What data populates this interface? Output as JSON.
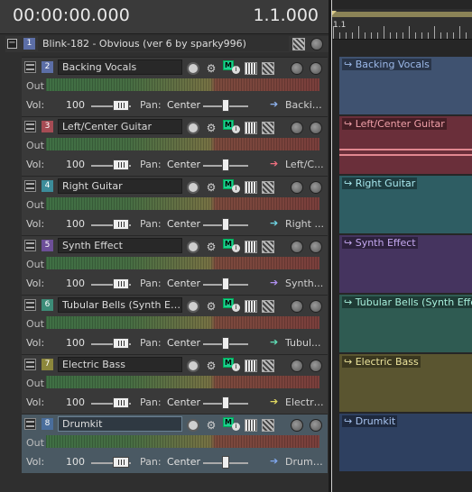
{
  "transport": {
    "time": "00:00:00.000",
    "beat": "1.1.000"
  },
  "ruler": {
    "label": "1.1"
  },
  "bus": {
    "number": "1",
    "name": "Blink-182 - Obvious (ver 6 by sparky996)",
    "expand": "−"
  },
  "labels": {
    "out": "Out",
    "vol": "Vol:",
    "pan": "Pan:",
    "monitor": "M"
  },
  "tracks": [
    {
      "number": "2",
      "name": "Backing Vocals",
      "volume": "100",
      "pan": "Center",
      "output": "Backin...",
      "clip": "Backing Vocals",
      "num_color": "#5c6ea6",
      "clip_color": "#3f5270",
      "label_color": "#9bb8e8",
      "arrow_color": "#8fb4f0",
      "selected": false
    },
    {
      "number": "3",
      "name": "Left/Center Guitar",
      "volume": "100",
      "pan": "Center",
      "output": "Left/C...",
      "clip": "Left/Center Guitar",
      "num_color": "#a64c54",
      "clip_color": "#6a2f3a",
      "label_color": "#f0a0a8",
      "arrow_color": "#f07080",
      "selected": false
    },
    {
      "number": "4",
      "name": "Right Guitar",
      "volume": "100",
      "pan": "Center",
      "output": "Right ...",
      "clip": "Right Guitar",
      "num_color": "#3c8c9a",
      "clip_color": "#2e5d63",
      "label_color": "#a8e8ee",
      "arrow_color": "#70d8e8",
      "selected": false
    },
    {
      "number": "5",
      "name": "Synth Effect",
      "volume": "100",
      "pan": "Center",
      "output": "Synth...",
      "clip": "Synth Effect",
      "num_color": "#6d4f98",
      "clip_color": "#45345f",
      "label_color": "#c4a8f0",
      "arrow_color": "#b090f0",
      "selected": false
    },
    {
      "number": "6",
      "name": "Tubular Bells (Synth Effe...",
      "volume": "100",
      "pan": "Center",
      "output": "Tubul...",
      "clip": "Tubular Bells (Synth Effect)",
      "num_color": "#3d8c78",
      "clip_color": "#2f5b52",
      "label_color": "#a8f0dc",
      "arrow_color": "#60e0b8",
      "selected": false
    },
    {
      "number": "7",
      "name": "Electric Bass",
      "volume": "100",
      "pan": "Center",
      "output": "Electri...",
      "clip": "Electric Bass",
      "num_color": "#8c873c",
      "clip_color": "#5a5530",
      "label_color": "#ece49c",
      "arrow_color": "#e0d860",
      "selected": false
    },
    {
      "number": "8",
      "name": "Drumkit",
      "volume": "100",
      "pan": "Center",
      "output": "Drumkit",
      "clip": "Drumkit",
      "num_color": "#4a6e9c",
      "clip_color": "#2e4060",
      "label_color": "#a8c4f0",
      "arrow_color": "#80a8f0",
      "selected": true
    }
  ]
}
